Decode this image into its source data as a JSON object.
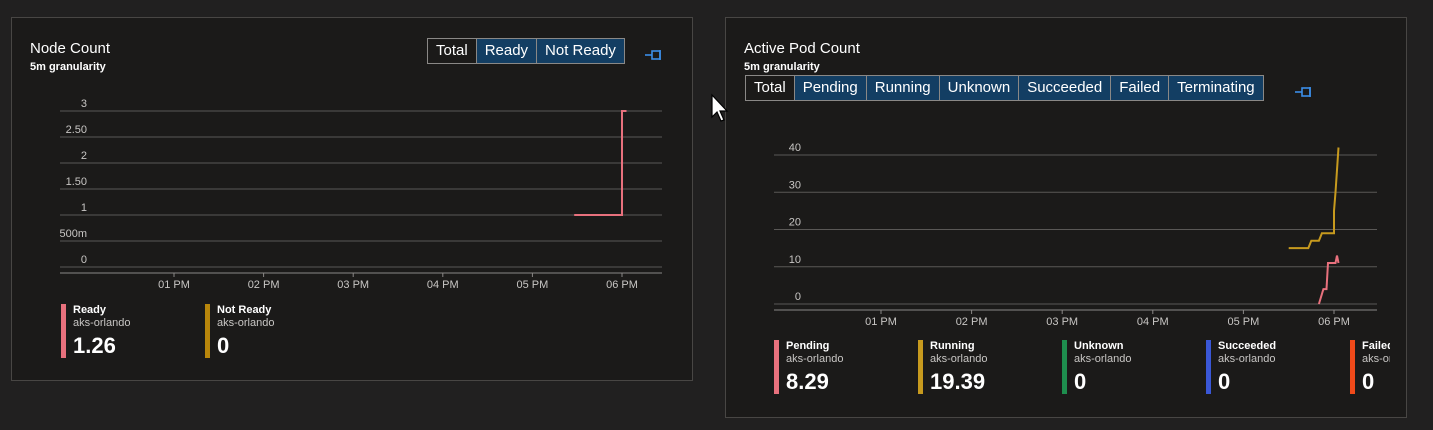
{
  "node_panel": {
    "title": "Node Count",
    "subtitle": "5m granularity",
    "tabs": [
      "Total",
      "Ready",
      "Not Ready"
    ],
    "selected_tab": "Total",
    "legend": [
      {
        "name": "Ready",
        "resource": "aks-orlando",
        "value": "1.26",
        "color": "#e8717d"
      },
      {
        "name": "Not Ready",
        "resource": "aks-orlando",
        "value": "0",
        "color": "#b8860b"
      }
    ]
  },
  "pod_panel": {
    "title": "Active Pod Count",
    "subtitle": "5m granularity",
    "tabs": [
      "Total",
      "Pending",
      "Running",
      "Unknown",
      "Succeeded",
      "Failed",
      "Terminating"
    ],
    "selected_tab": "Total",
    "legend": [
      {
        "name": "Pending",
        "resource": "aks-orlando",
        "value": "8.29",
        "color": "#e8717d"
      },
      {
        "name": "Running",
        "resource": "aks-orlando",
        "value": "19.39",
        "color": "#c79a1e"
      },
      {
        "name": "Unknown",
        "resource": "aks-orlando",
        "value": "0",
        "color": "#1e8e4e"
      },
      {
        "name": "Succeeded",
        "resource": "aks-orlando",
        "value": "0",
        "color": "#3a57d6"
      },
      {
        "name": "Failed",
        "resource": "aks-orlando",
        "value": "0",
        "color": "#f04a1a"
      }
    ]
  },
  "chart_data": [
    {
      "type": "line",
      "title": "Node Count",
      "x_ticks": [
        "01 PM",
        "02 PM",
        "03 PM",
        "04 PM",
        "05 PM",
        "06 PM"
      ],
      "y_ticks": [
        "0",
        "500m",
        "1",
        "1.50",
        "2",
        "2.50",
        "3"
      ],
      "ylim": [
        0,
        3
      ],
      "grid": true,
      "series": [
        {
          "name": "Ready",
          "color": "#e8717d",
          "points": [
            [
              "05:28 PM",
              1
            ],
            [
              "06:00 PM",
              1
            ],
            [
              "06:00 PM",
              3
            ],
            [
              "06:03 PM",
              3
            ]
          ]
        },
        {
          "name": "Not Ready",
          "color": "#b8860b",
          "points": []
        }
      ]
    },
    {
      "type": "line",
      "title": "Active Pod Count",
      "x_ticks": [
        "01 PM",
        "02 PM",
        "03 PM",
        "04 PM",
        "05 PM",
        "06 PM"
      ],
      "y_ticks": [
        "0",
        "10",
        "20",
        "30",
        "40"
      ],
      "ylim": [
        0,
        40
      ],
      "grid": true,
      "series": [
        {
          "name": "Running",
          "color": "#c79a1e",
          "points": [
            [
              "05:30 PM",
              15
            ],
            [
              "05:43 PM",
              15
            ],
            [
              "05:45 PM",
              17
            ],
            [
              "05:50 PM",
              17
            ],
            [
              "05:52 PM",
              19
            ],
            [
              "06:00 PM",
              19
            ],
            [
              "06:00 PM",
              25
            ],
            [
              "06:01 PM",
              30
            ],
            [
              "06:03 PM",
              42
            ]
          ]
        },
        {
          "name": "Pending",
          "color": "#e8717d",
          "points": [
            [
              "05:50 PM",
              0
            ],
            [
              "05:53 PM",
              4
            ],
            [
              "05:55 PM",
              4
            ],
            [
              "05:56 PM",
              11
            ],
            [
              "06:01 PM",
              11
            ],
            [
              "06:02 PM",
              13
            ],
            [
              "06:03 PM",
              11
            ]
          ]
        }
      ]
    }
  ]
}
